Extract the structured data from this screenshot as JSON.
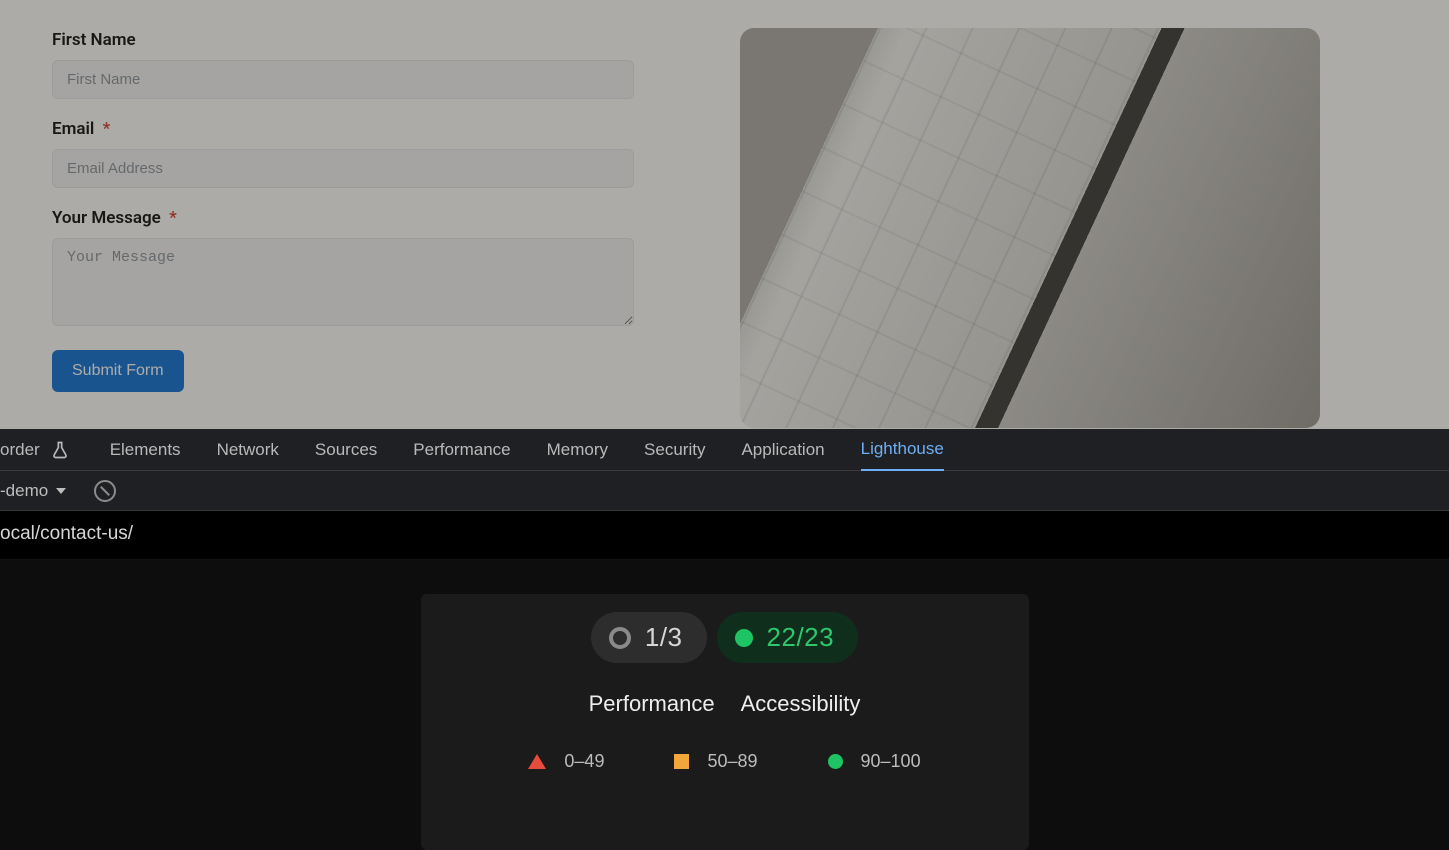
{
  "form": {
    "first_name_label": "First Name",
    "first_name_placeholder": "First Name",
    "email_label": "Email",
    "email_placeholder": "Email Address",
    "message_label": "Your Message",
    "message_placeholder": "Your Message",
    "submit_label": "Submit Form",
    "required_mark": "*"
  },
  "devtools": {
    "leading_text": "order",
    "tabs": [
      "Elements",
      "Network",
      "Sources",
      "Performance",
      "Memory",
      "Security",
      "Application",
      "Lighthouse"
    ],
    "active_tab": "Lighthouse",
    "dropdown_text": "-demo",
    "url_text": "ocal/contact-us/"
  },
  "lighthouse": {
    "perf_score": "1/3",
    "a11y_score": "22/23",
    "categories": [
      "Performance",
      "Accessibility"
    ],
    "legend": {
      "low": "0–49",
      "mid": "50–89",
      "high": "90–100"
    }
  }
}
